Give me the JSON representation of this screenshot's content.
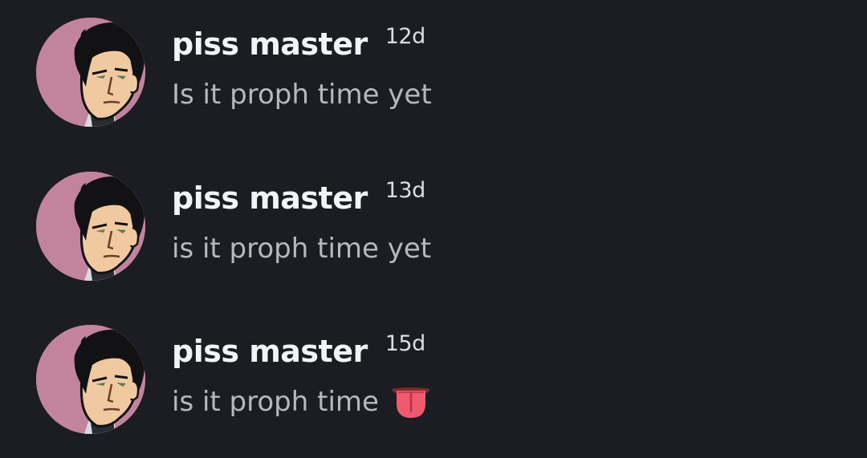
{
  "messages": [
    {
      "username": "piss master",
      "timestamp": "12d",
      "text": "Is it proph time yet",
      "emoji": ""
    },
    {
      "username": "piss master",
      "timestamp": "13d",
      "text": "is it proph time yet",
      "emoji": ""
    },
    {
      "username": "piss master",
      "timestamp": "15d",
      "text": "is it proph time",
      "emoji": "tongue-emoji"
    }
  ],
  "colors": {
    "background": "#1c1d22",
    "username": "#f2f3f5",
    "message_text": "#b6b8bf",
    "avatar_bg": "#c88aa3",
    "emoji_tongue": "#ef5a6f"
  }
}
